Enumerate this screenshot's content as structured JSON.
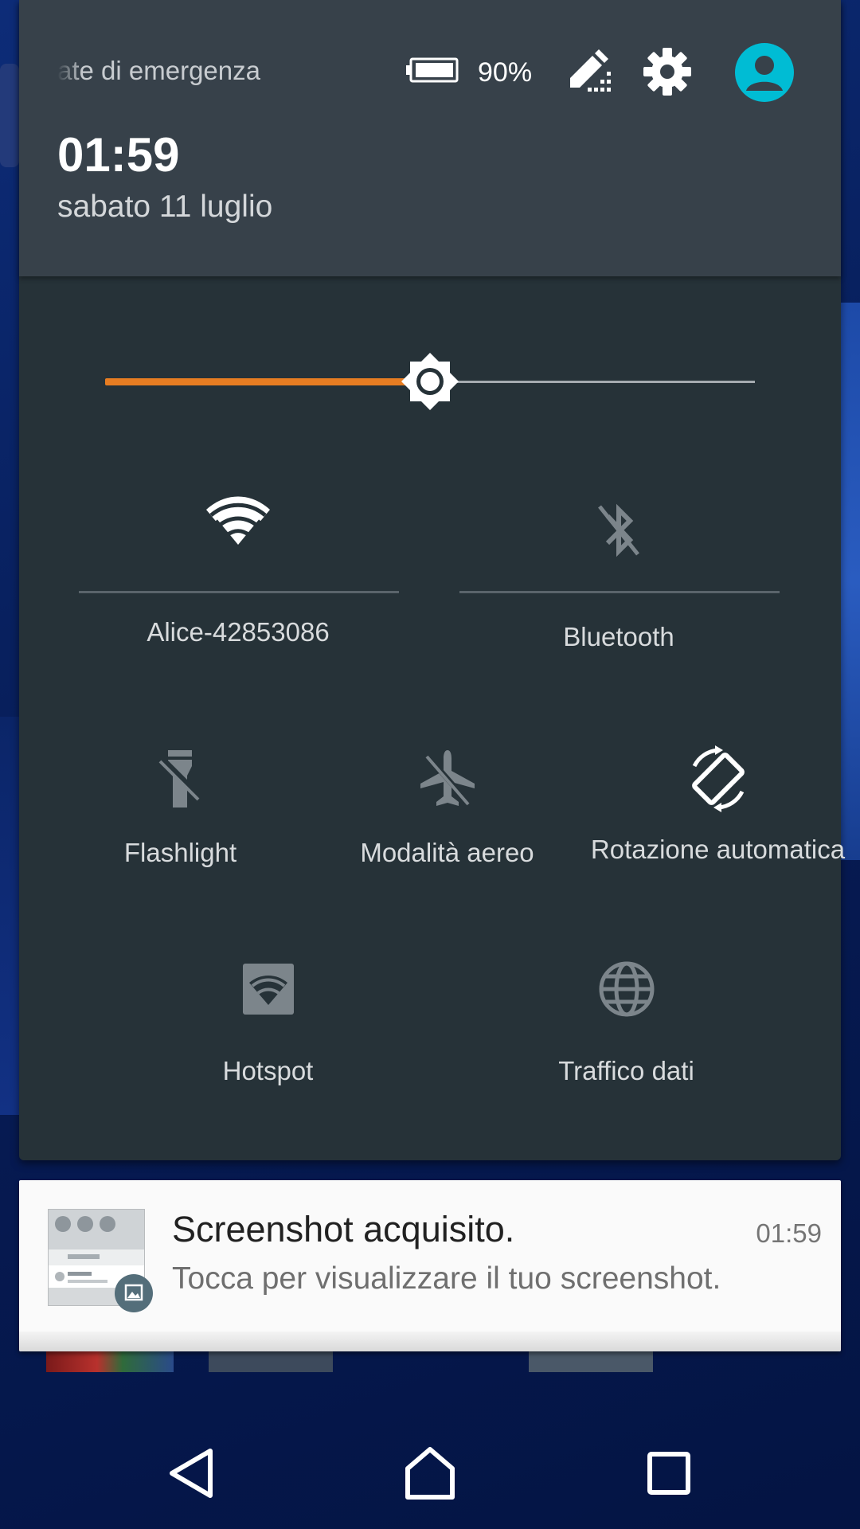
{
  "status_header": {
    "emergency_text": "ate di emergenza",
    "battery_percent": "90%",
    "time": "01:59",
    "date": "sabato 11 luglio",
    "icons": [
      "battery-icon",
      "edit-icon",
      "gear-icon",
      "account-icon"
    ]
  },
  "brightness": {
    "level": 0.5,
    "accent_color": "#e77d22",
    "icon": "brightness-icon"
  },
  "tiles": {
    "wifi": {
      "label": "Alice-42853086",
      "icon": "wifi-icon",
      "active": true
    },
    "bluetooth": {
      "label": "Bluetooth",
      "icon": "bluetooth-disabled-icon",
      "active": false
    },
    "flashlight": {
      "label": "Flashlight",
      "icon": "flashlight-icon",
      "active": false
    },
    "airplane": {
      "label": "Modalità aereo",
      "icon": "airplane-mode-icon",
      "active": false
    },
    "rotation": {
      "label": "Rotazione automatica",
      "icon": "auto-rotate-icon",
      "active": true
    },
    "hotspot": {
      "label": "Hotspot",
      "icon": "hotspot-icon",
      "active": false
    },
    "data": {
      "label": "Traffico dati",
      "icon": "globe-icon",
      "active": false
    }
  },
  "notification": {
    "title": "Screenshot acquisito.",
    "time": "01:59",
    "text": "Tocca per visualizzare il tuo screenshot.",
    "badge_icon": "image-icon"
  },
  "nav": {
    "icons": [
      "back-icon",
      "home-icon",
      "recents-icon"
    ]
  },
  "colors": {
    "panel": "#263238",
    "header": "#37414a",
    "avatar": "#00bcd4"
  }
}
